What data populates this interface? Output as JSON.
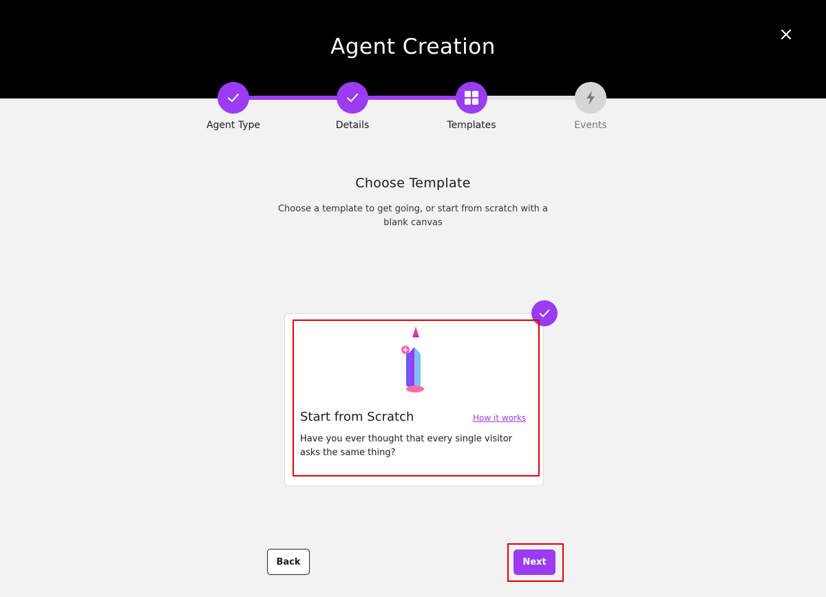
{
  "header": {
    "title": "Agent Creation",
    "close_icon": "close-icon"
  },
  "stepper": {
    "steps": [
      {
        "label": "Agent Type",
        "state": "completed",
        "icon": "check-icon"
      },
      {
        "label": "Details",
        "state": "completed",
        "icon": "check-icon"
      },
      {
        "label": "Templates",
        "state": "current",
        "icon": "grid-icon"
      },
      {
        "label": "Events",
        "state": "upcoming",
        "icon": "lightning-icon"
      }
    ]
  },
  "main": {
    "heading": "Choose Template",
    "subtext": "Choose a template to get going, or start from scratch with a blank canvas"
  },
  "template_card": {
    "title": "Start from Scratch",
    "link": "How it works",
    "description": "Have you ever thought that every single visitor asks the same thing?",
    "selected": true,
    "icon": "pencil-icon"
  },
  "footer": {
    "back_label": "Back",
    "next_label": "Next"
  },
  "colors": {
    "accent": "#9b3cf2",
    "header_bg": "#000000",
    "page_bg": "#f2f2f2",
    "highlight": "#e00000"
  }
}
